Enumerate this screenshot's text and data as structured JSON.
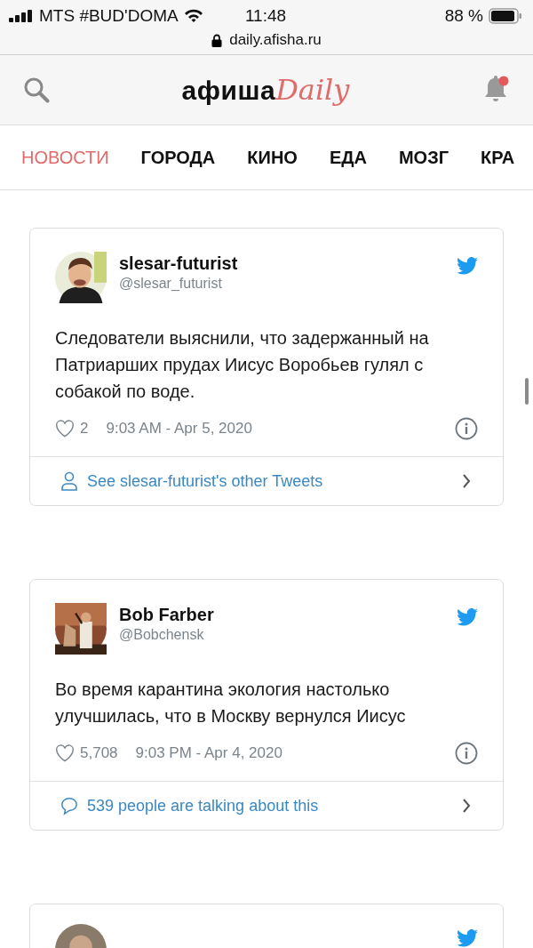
{
  "status_bar": {
    "carrier": "MTS #BUD'DOMA",
    "time": "11:48",
    "battery": "88 %",
    "url": "daily.afisha.ru"
  },
  "header": {
    "logo_main": "афиша",
    "logo_accent": "Daily",
    "notifications_unread": true
  },
  "tabs": [
    {
      "label": "НОВОСТИ",
      "selected": true
    },
    {
      "label": "ГОРОДА",
      "selected": false
    },
    {
      "label": "КИНО",
      "selected": false
    },
    {
      "label": "ЕДА",
      "selected": false
    },
    {
      "label": "МОЗГ",
      "selected": false
    },
    {
      "label": "КРА",
      "selected": false
    }
  ],
  "tweets": [
    {
      "name": "slesar-futurist",
      "handle": "@slesar_futurist",
      "text": "Следователи выяснили, что задержанный на Патриарших прудах Иисус Воробьев гулял с собакой по воде.",
      "likes": "2",
      "time": "9:03 AM - Apr 5, 2020",
      "footer": {
        "kind": "profile",
        "label": "See slesar-futurist's other Tweets"
      }
    },
    {
      "name": "Bob Farber",
      "handle": "@Bobchensk",
      "text": "Во время карантина экология настолько улучшилась, что в Москву вернулся Иисус",
      "likes": "5,708",
      "time": "9:03 PM - Apr 4, 2020",
      "footer": {
        "kind": "conversation",
        "label": "539 people are talking about this"
      }
    },
    {
      "kind": "cut"
    }
  ]
}
